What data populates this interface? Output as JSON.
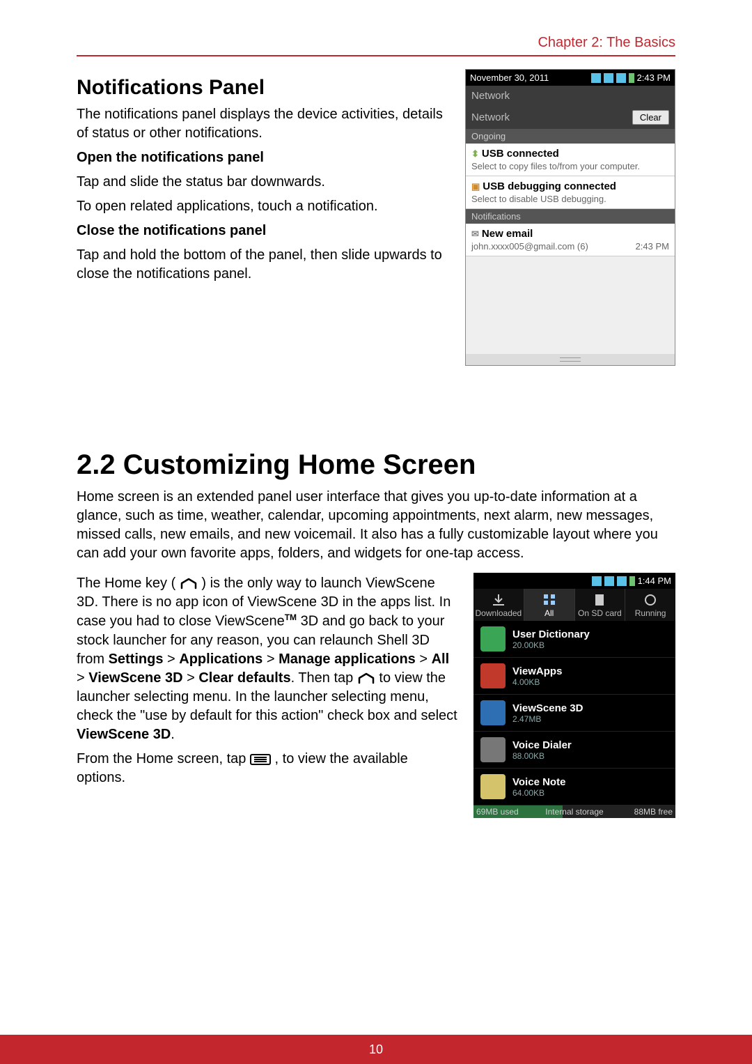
{
  "header": {
    "chapter": "Chapter 2: The Basics"
  },
  "notifPanel": {
    "title": "Notifications Panel",
    "intro": "The notifications panel displays the device activities, details of status or other notifications.",
    "openTitle": "Open the notifications panel",
    "openLine1": "Tap and slide the status bar downwards.",
    "openLine2": "To open related applications, touch a notification.",
    "closeTitle": "Close the notifications panel",
    "closeBody": "Tap and hold the bottom of the panel, then slide upwards to close the notifications panel."
  },
  "customizing": {
    "title": "2.2 Customizing Home Screen",
    "intro": "Home screen is an extended panel user interface that gives you up-to-date information at a glance, such as time, weather, calendar, upcoming appointments, next alarm, new messages, missed calls, new emails, and new voicemail. It also has a fully customizable layout where you can add your own favorite apps, folders, and widgets for one-tap access.",
    "p2a": "The Home key (",
    "p2b": ") is the only way to launch ViewScene 3D. There is no app icon of ViewScene 3D in the apps list. In case you had to close ViewScene",
    "tm": "TM",
    "p2c": " 3D and go back to your stock launcher for any reason, you can relaunch Shell 3D from ",
    "p2_settings": "Settings",
    "sep": " > ",
    "p2_apps": "Applications",
    "p2_manage": "Manage applications",
    "p2_all": "All",
    "p2_vs3d": "ViewScene 3D",
    "p2_clear": "Clear defaults",
    "p2d": ". Then tap ",
    "p2e": " to view the launcher selecting menu. In the launcher selecting menu, check the \"use by default for this action\" check box and select ",
    "p2f": ".",
    "p3a": "From the Home screen, tap ",
    "p3b": ", to view the available options."
  },
  "phone1": {
    "date": "November 30, 2011",
    "time": "2:43 PM",
    "net1": "Network",
    "net2": "Network",
    "clear": "Clear",
    "ongoing": "Ongoing",
    "usbTitle": "USB connected",
    "usbSub": "Select to copy files to/from your computer.",
    "dbgTitle": "USB debugging connected",
    "dbgSub": "Select to disable USB debugging.",
    "notifsLabel": "Notifications",
    "mailTitle": "New email",
    "mailSub": "john.xxxx005@gmail.com (6)",
    "mailTime": "2:43 PM"
  },
  "phone2": {
    "time": "1:44 PM",
    "tabs": {
      "downloaded": "Downloaded",
      "all": "All",
      "sd": "On SD card",
      "running": "Running"
    },
    "apps": [
      {
        "name": "User Dictionary",
        "size": "20.00KB",
        "bg": "#3aa655"
      },
      {
        "name": "ViewApps",
        "size": "4.00KB",
        "bg": "#c0392b"
      },
      {
        "name": "ViewScene 3D",
        "size": "2.47MB",
        "bg": "#2e6fb3"
      },
      {
        "name": "Voice Dialer",
        "size": "88.00KB",
        "bg": "#777777"
      },
      {
        "name": "Voice Note",
        "size": "64.00KB",
        "bg": "#d4c36a"
      }
    ],
    "storageLabel": "Internal storage",
    "used": "69MB used",
    "free": "88MB free"
  },
  "footer": {
    "page": "10"
  }
}
